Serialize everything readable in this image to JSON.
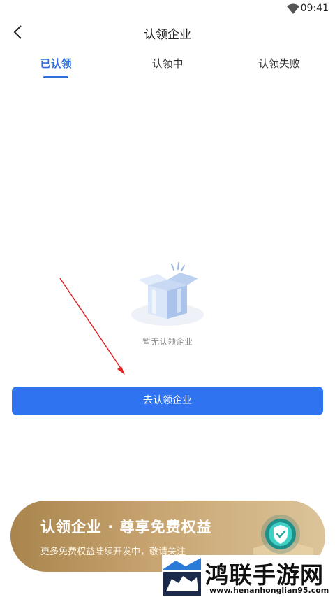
{
  "status_bar": {
    "time": "09:41"
  },
  "nav": {
    "title": "认领企业"
  },
  "tabs": [
    {
      "label": "已认领",
      "active": true
    },
    {
      "label": "认领中",
      "active": false
    },
    {
      "label": "认领失败",
      "active": false
    }
  ],
  "empty_state": {
    "text": "暂无认领企业"
  },
  "primary_button": {
    "label": "去认领企业"
  },
  "promo": {
    "title": "认领企业 · 尊享免费权益",
    "subtitle": "更多免费权益陆续开发中，敬请关注"
  },
  "watermark": {
    "text": "鸿联手游网",
    "url": "www.henanhonglian95.com"
  },
  "colors": {
    "accent": "#2f6de0",
    "button": "#2f73f0",
    "promo_gold": "#c7a470",
    "annotation_arrow": "#e02020"
  },
  "icons": [
    "wifi-icon",
    "back-arrow-icon",
    "empty-box-icon",
    "shield-check-icon"
  ]
}
